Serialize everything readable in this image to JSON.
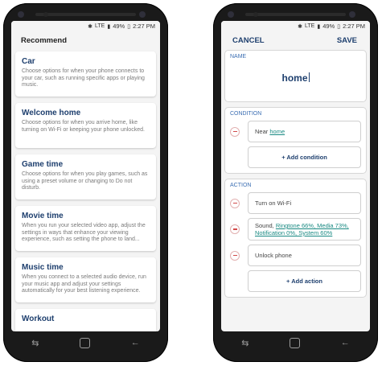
{
  "status": {
    "battery": "49%",
    "time": "2:27 PM",
    "signal_label": "LTE"
  },
  "left": {
    "heading": "Recommend",
    "cards": [
      {
        "title": "Car",
        "desc": "Choose options for when your phone connects to your car, such as running specific apps or playing music."
      },
      {
        "title": "Welcome home",
        "desc": "Choose options for when you arrive home, like turning on Wi-Fi or keeping your phone unlocked."
      },
      {
        "title": "Game time",
        "desc": "Choose options for when you play games, such as using a preset volume or changing to Do not disturb."
      },
      {
        "title": "Movie time",
        "desc": "When you run your selected video app, adjust the settings in ways that enhance your viewing experience, such as setting the phone to land..."
      },
      {
        "title": "Music time",
        "desc": "When you connect to a selected audio device, run your music app and adjust your settings automatically for your best listening experience."
      },
      {
        "title": "Workout",
        "desc": ""
      }
    ]
  },
  "right": {
    "cancel": "CANCEL",
    "save": "SAVE",
    "name_label": "NAME",
    "name_value": "home",
    "condition_label": "CONDITION",
    "condition_prefix": "Near",
    "condition_link": "home",
    "add_condition": "+ Add condition",
    "action_label": "ACTION",
    "action_wifi": "Turn on Wi-Fi",
    "action_sound_prefix": "Sound,",
    "action_sound_link1": "Ringtone 66%, Media 73%,",
    "action_sound_link2": "Notification 0%, System 60%",
    "action_unlock": "Unlock phone",
    "add_action": "+ Add action"
  }
}
